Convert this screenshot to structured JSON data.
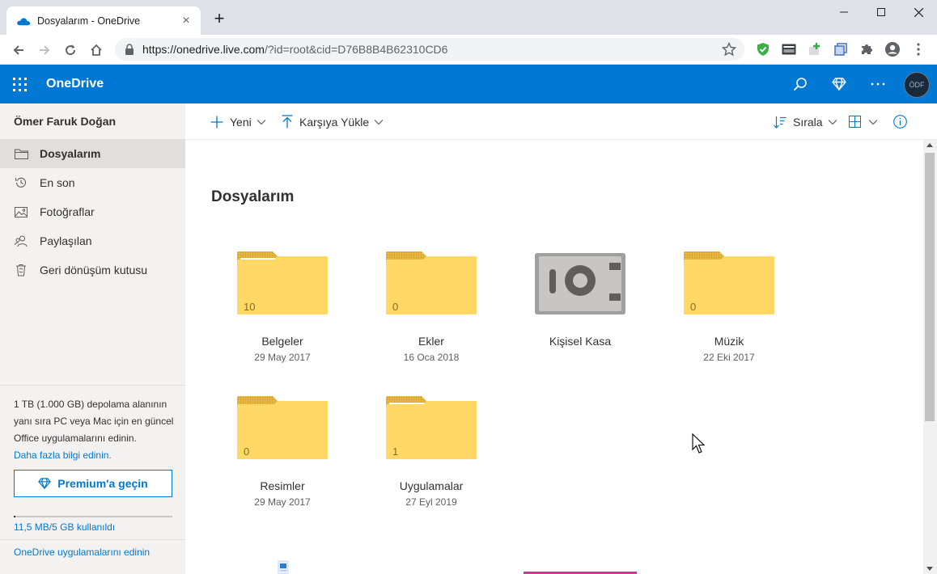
{
  "browser": {
    "tab_title": "Dosyalarım - OneDrive",
    "tab_close": "×",
    "new_tab": "+",
    "url_host": "https://onedrive.live.com",
    "url_path": "/?id=root&cid=D76B8B4B62310CD6"
  },
  "header": {
    "brand": "OneDrive",
    "avatar_initials": "ÖDF"
  },
  "sidebar": {
    "user_name": "Ömer Faruk Doğan",
    "items": [
      {
        "label": "Dosyalarım",
        "icon": "folder-icon",
        "active": true
      },
      {
        "label": "En son",
        "icon": "history-icon"
      },
      {
        "label": "Fotoğraflar",
        "icon": "photo-icon"
      },
      {
        "label": "Paylaşılan",
        "icon": "people-icon"
      },
      {
        "label": "Geri dönüşüm kutusu",
        "icon": "recycle-bin-icon"
      }
    ],
    "promo_text": "1 TB (1.000 GB) depolama alanının yanı sıra PC veya Mac için en güncel Office uygulamalarını edinin.",
    "promo_link": "Daha fazla bilgi edinin.",
    "premium_button": "Premium'a geçin",
    "quota_fraction": 0.0023,
    "quota_text": "11,5 MB/5 GB kullanıldı",
    "get_apps": "OneDrive uygulamalarını edinin"
  },
  "commandbar": {
    "new_label": "Yeni",
    "upload_label": "Karşıya Yükle",
    "sort_label": "Sırala"
  },
  "main": {
    "title": "Dosyalarım",
    "tiles": [
      {
        "name": "Belgeler",
        "date": "29 May 2017",
        "count": "10",
        "kind": "folder-papers"
      },
      {
        "name": "Ekler",
        "date": "16 Oca 2018",
        "count": "0",
        "kind": "folder"
      },
      {
        "name": "Kişisel Kasa",
        "date": "",
        "count": "",
        "kind": "vault"
      },
      {
        "name": "Müzik",
        "date": "22 Eki 2017",
        "count": "0",
        "kind": "folder"
      },
      {
        "name": "Resimler",
        "date": "29 May 2017",
        "count": "0",
        "kind": "folder"
      },
      {
        "name": "Uygulamalar",
        "date": "27 Eyl 2019",
        "count": "1",
        "kind": "folder-papers"
      }
    ]
  },
  "colors": {
    "brand_blue": "#0078d4",
    "folder_yellow": "#ffd865",
    "folder_tab": "#e8b73d",
    "sidebar_bg": "#f3f2f1"
  }
}
